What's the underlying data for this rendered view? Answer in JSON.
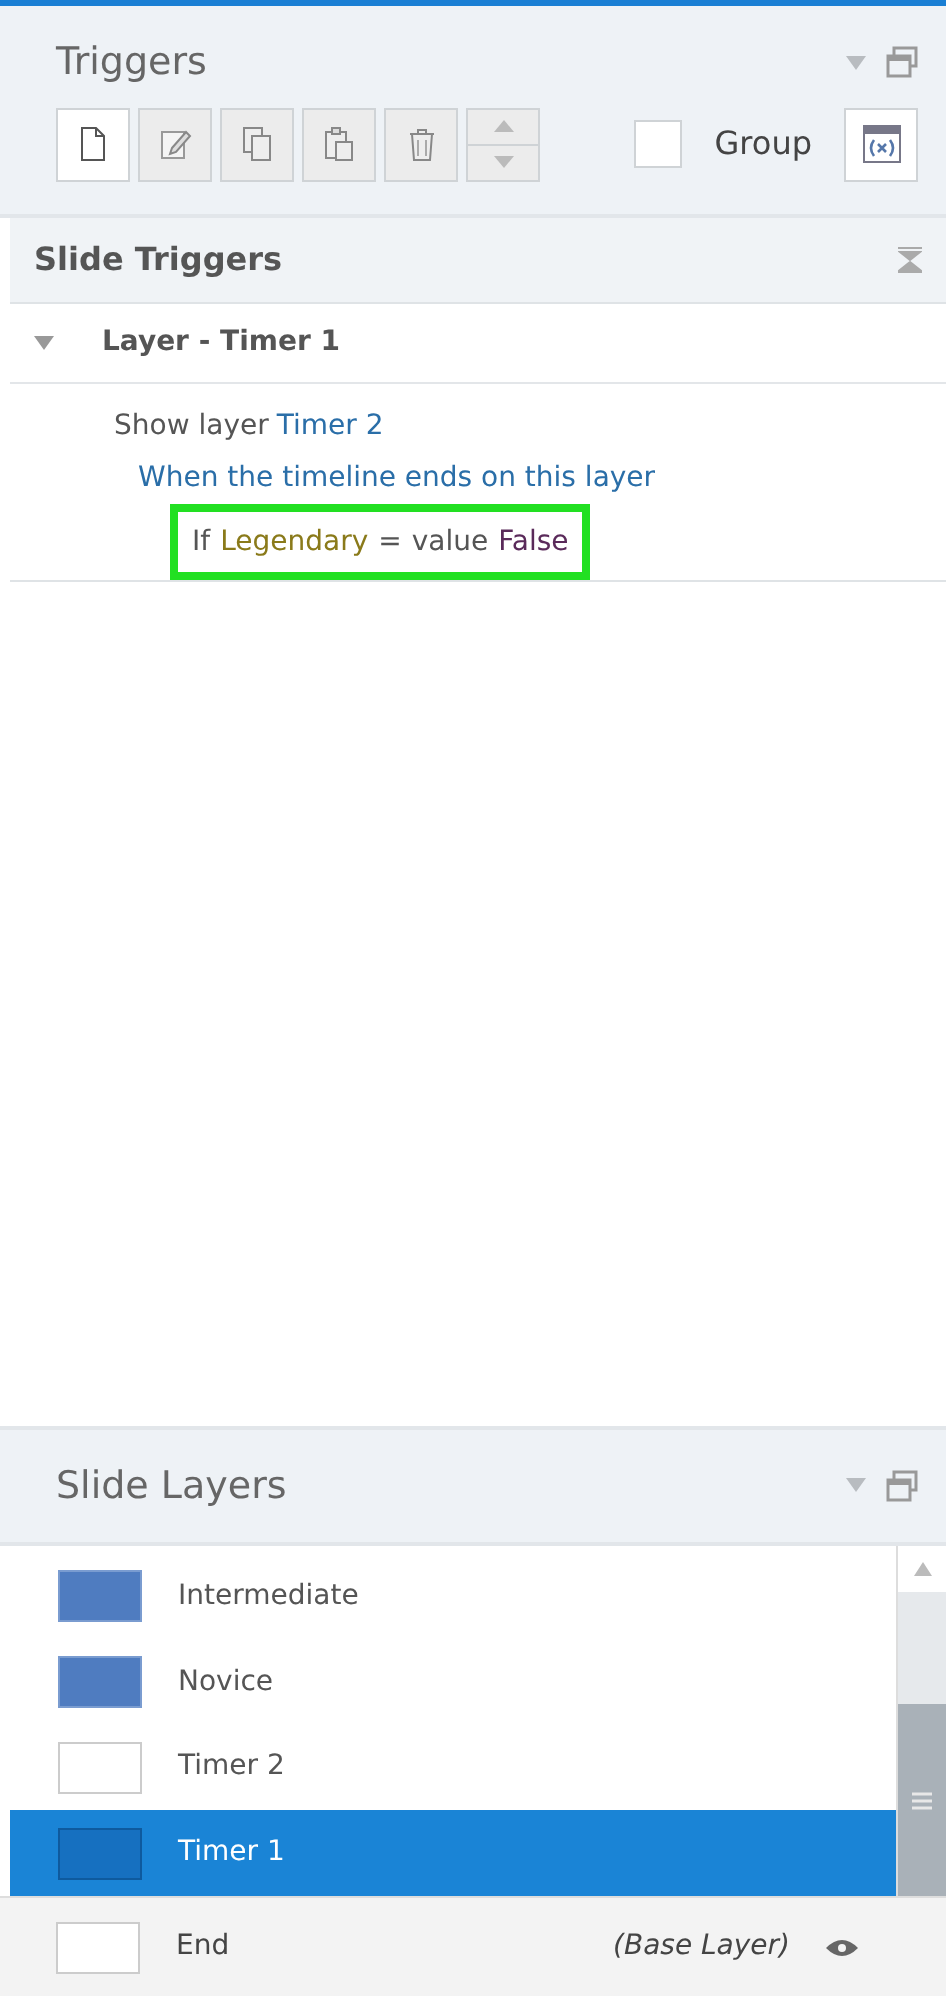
{
  "triggers_panel": {
    "title": "Triggers",
    "toolbar": [
      {
        "kind": "new",
        "disabled": false
      },
      {
        "kind": "edit",
        "disabled": true
      },
      {
        "kind": "copy",
        "disabled": true
      },
      {
        "kind": "paste",
        "disabled": true
      },
      {
        "kind": "delete",
        "disabled": true
      },
      {
        "kind": "move",
        "disabled": true
      }
    ],
    "group": {
      "label": "Group",
      "checked": false
    },
    "section": {
      "title": "Slide Triggers"
    },
    "groups": [
      {
        "title": "Layer - Timer 1",
        "expanded": true,
        "triggers": [
          {
            "action": [
              {
                "kind": "text",
                "text": "Show layer"
              },
              {
                "kind": "link",
                "text": "Timer 2"
              }
            ],
            "event": [
              {
                "kind": "link",
                "text": "When the timeline ends on this layer"
              }
            ],
            "condition": {
              "highlighted": true,
              "parts": [
                {
                  "kind": "text",
                  "text": "If"
                },
                {
                  "kind": "variable",
                  "text": "Legendary"
                },
                {
                  "kind": "text",
                  "text": "="
                },
                {
                  "kind": "text",
                  "text": "value"
                },
                {
                  "kind": "value",
                  "text": "False"
                }
              ]
            }
          }
        ]
      }
    ]
  },
  "layers_panel": {
    "title": "Slide Layers",
    "layers": [
      {
        "name": "Intermediate",
        "kind": "blue",
        "selected": false
      },
      {
        "name": "Novice",
        "kind": "blue",
        "selected": false
      },
      {
        "name": "Timer 2",
        "kind": "blank",
        "selected": false
      },
      {
        "name": "Timer 1",
        "kind": "dark",
        "selected": true
      }
    ],
    "base": {
      "name": "End",
      "note": "(Base Layer)"
    }
  }
}
